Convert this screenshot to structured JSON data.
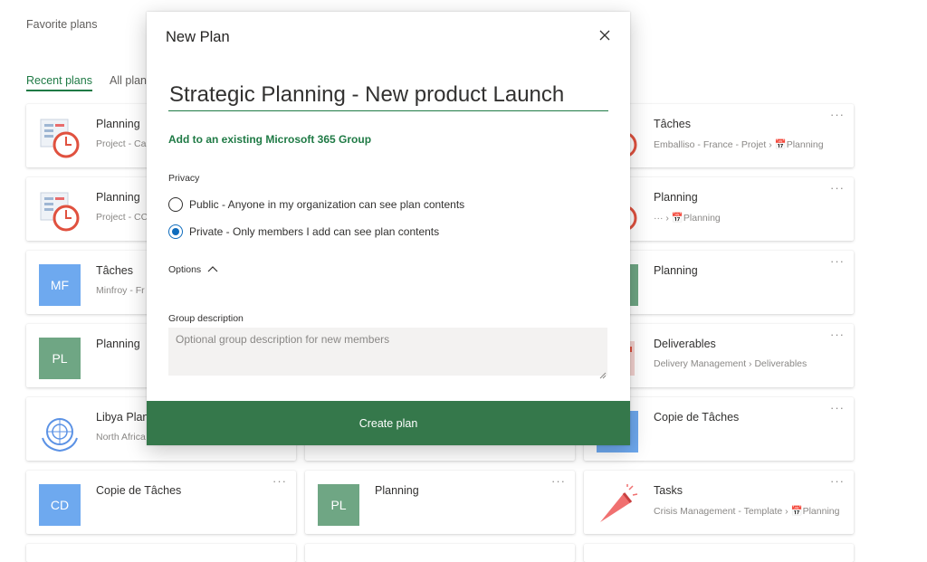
{
  "page": {
    "favorite_title": "Favorite plans",
    "tabs": [
      {
        "label": "Recent plans",
        "active": true
      },
      {
        "label": "All plans",
        "active": false
      }
    ]
  },
  "cards": [
    {
      "title": "Planning",
      "sub": "Project - Ca",
      "thumb_icon": "planner-clock-icon",
      "thumb_color": ""
    },
    {
      "title": "Planning",
      "sub": "Project - CC",
      "thumb_icon": "planner-clock-icon",
      "thumb_color": ""
    },
    {
      "title": "Tâches",
      "sub": "Minfroy - Fr",
      "thumb_text": "MF",
      "thumb_color": "#6ea9ef"
    },
    {
      "title": "Planning",
      "sub": "",
      "thumb_text": "PL",
      "thumb_color": "#6fa684"
    },
    {
      "title": "Libya Plan",
      "sub": "North Africa",
      "thumb_icon": "un-emblem-icon",
      "thumb_color": ""
    },
    {
      "title": "Copie de Tâches",
      "sub": "",
      "thumb_text": "CD",
      "thumb_color": "#6ea9ef"
    },
    {
      "title": "Planning",
      "sub": "",
      "thumb_text": "PL",
      "thumb_color": "#6fa684"
    },
    {
      "title": "Tâches",
      "sub": "Emballiso - France - Projet  ›  📅Planning",
      "thumb_icon": "planner-clock-icon",
      "thumb_color": ""
    },
    {
      "title": "Planning",
      "sub": "···  ›  📅Planning",
      "thumb_icon": "planner-clock-icon",
      "thumb_color": ""
    },
    {
      "title": "Planning",
      "sub": "",
      "thumb_color": "#6fa684"
    },
    {
      "title": "Deliverables",
      "sub": "Delivery Management  ›  Deliverables",
      "thumb_icon": "deliverables-icon",
      "thumb_color": ""
    },
    {
      "title": "Copie de Tâches",
      "sub": "",
      "thumb_color": "#6ea9ef"
    },
    {
      "title": "Tasks",
      "sub": "Crisis Management - Template  ›  📅Planning",
      "thumb_icon": "megaphone-icon",
      "thumb_color": ""
    }
  ],
  "more_label": "···",
  "modal": {
    "title": "New Plan",
    "plan_name_value": "Strategic Planning - New product Launch",
    "group_link": "Add to an existing Microsoft 365 Group",
    "privacy_label": "Privacy",
    "privacy_options": [
      {
        "label": "Public - Anyone in my organization can see plan contents",
        "checked": false
      },
      {
        "label": "Private - Only members I add can see plan contents",
        "checked": true
      }
    ],
    "options_label": "Options",
    "group_description_label": "Group description",
    "group_description_placeholder": "Optional group description for new members",
    "create_button": "Create plan"
  },
  "colors": {
    "accent_green": "#1f7a45",
    "button_green": "#35784b",
    "radio_blue": "#0f6cbd"
  }
}
